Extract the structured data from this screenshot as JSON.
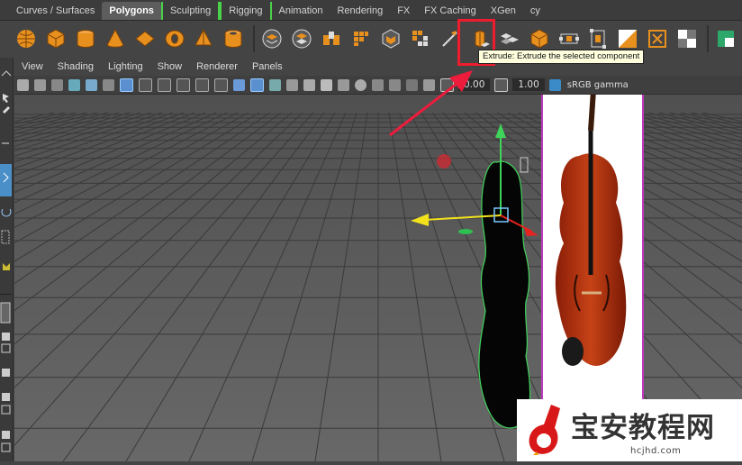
{
  "shelf": {
    "tabs": [
      {
        "label": "Curves / Surfaces"
      },
      {
        "label": "Polygons",
        "active": true
      },
      {
        "label": "Sculpting"
      },
      {
        "label": "Rigging"
      },
      {
        "label": "Animation"
      },
      {
        "label": "Rendering"
      },
      {
        "label": "FX"
      },
      {
        "label": "FX Caching"
      },
      {
        "label": "XGen"
      },
      {
        "label": "cy"
      }
    ],
    "icon_names": [
      "sphere-icon",
      "cube-icon",
      "cylinder-icon",
      "cone-icon",
      "plane-icon",
      "torus-icon",
      "pyramid-icon",
      "pipe-icon",
      "combine-icon",
      "separate-icon",
      "extract-icon",
      "smooth-icon",
      "mirror-icon",
      "bridge-icon",
      "multi-cut-icon",
      "extrude-icon",
      "bevel-icon",
      "boolean-icon",
      "poke-icon",
      "wedge-icon",
      "uv-editor-icon",
      "fill-hole-icon",
      "checker-icon",
      "green-cube-icon"
    ],
    "tooltip": "Extrude: Extrude the selected component"
  },
  "panel": {
    "menu": [
      "View",
      "Shading",
      "Lighting",
      "Show",
      "Renderer",
      "Panels"
    ],
    "exposure_value": "0.00",
    "gamma_value": "1.00",
    "color_space": "sRGB gamma"
  },
  "watermark": {
    "title": "宝安教程网",
    "url": "hcjhd.com"
  },
  "colors": {
    "accent_orange": "#e8901e",
    "highlight_red": "#ee1c2c",
    "selection_green": "#3fd45a",
    "viewport_bg": "#5c5c5c",
    "violin_red": "#b3310f"
  }
}
